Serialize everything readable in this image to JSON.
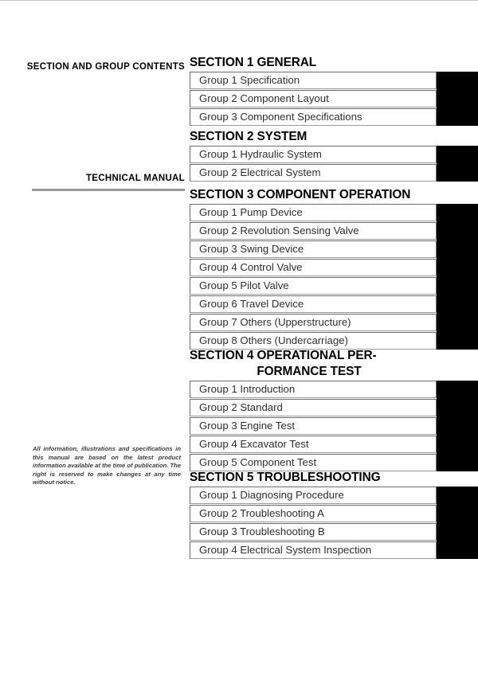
{
  "document": {
    "left_column": {
      "contents_heading": "SECTION AND GROUP CONTENTS",
      "manual_heading": "TECHNICAL MANUAL",
      "disclaimer": "All information, illustrations and specifications in this manual are based on the latest product information available at the time of publication. The right is reserved to make changes at any time without notice."
    },
    "sections": [
      {
        "title": "SECTION 1 GENERAL",
        "title_line2": "",
        "groups": [
          "Group 1 Specification",
          "Group 2 Component Layout",
          "Group 3 Component Specifications"
        ]
      },
      {
        "title": "SECTION 2 SYSTEM",
        "title_line2": "",
        "groups": [
          "Group 1 Hydraulic System",
          "Group 2 Electrical System"
        ]
      },
      {
        "title": "SECTION 3 COMPONENT OPERATION",
        "title_line2": "",
        "groups": [
          "Group 1 Pump Device",
          "Group 2 Revolution Sensing Valve",
          "Group 3 Swing Device",
          "Group 4 Control Valve",
          "Group 5 Pilot Valve",
          "Group 6 Travel Device",
          "Group 7 Others (Upperstructure)",
          "Group 8 Others (Undercarriage)"
        ]
      },
      {
        "title": "SECTION 4  OPERATIONAL PER-",
        "title_line2": "FORMANCE TEST",
        "groups": [
          "Group 1 Introduction",
          "Group 2 Standard",
          "Group 3 Engine Test",
          "Group 4 Excavator Test",
          "Group 5 Component Test"
        ]
      },
      {
        "title": "SECTION 5 TROUBLESHOOTING",
        "title_line2": "",
        "groups": [
          "Group 1 Diagnosing Procedure",
          "Group 2 Troubleshooting A",
          "Group 3 Troubleshooting B",
          "Group 4 Electrical System Inspection"
        ]
      }
    ]
  },
  "colors": {
    "tab_black": "#000000",
    "rule_gray": "#9a9a9a",
    "text_dark": "#2f2f2f"
  }
}
